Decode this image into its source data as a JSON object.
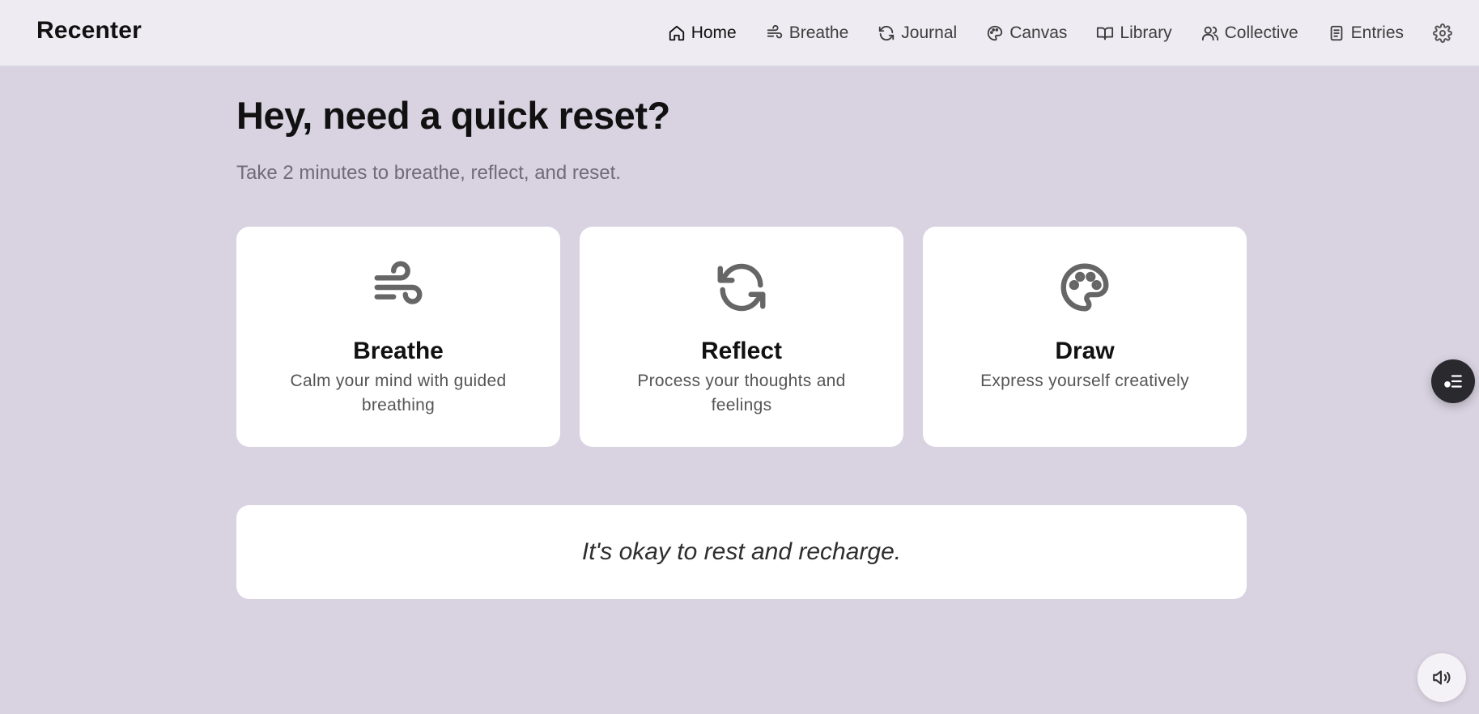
{
  "app": {
    "brand": "Recenter"
  },
  "nav": {
    "items": [
      {
        "label": "Home",
        "icon": "home-icon",
        "active": true
      },
      {
        "label": "Breathe",
        "icon": "wind-icon",
        "active": false
      },
      {
        "label": "Journal",
        "icon": "refresh-icon",
        "active": false
      },
      {
        "label": "Canvas",
        "icon": "palette-icon",
        "active": false
      },
      {
        "label": "Library",
        "icon": "book-icon",
        "active": false
      },
      {
        "label": "Collective",
        "icon": "users-icon",
        "active": false
      },
      {
        "label": "Entries",
        "icon": "document-icon",
        "active": false
      }
    ],
    "settings_icon": "gear-icon"
  },
  "hero": {
    "title": "Hey, need a quick reset?",
    "subtitle": "Take 2 minutes to breathe, reflect, and reset."
  },
  "cards": [
    {
      "title": "Breathe",
      "description": "Calm your mind with guided breathing",
      "icon": "wind-icon"
    },
    {
      "title": "Reflect",
      "description": "Process your thoughts and feelings",
      "icon": "refresh-icon"
    },
    {
      "title": "Draw",
      "description": "Express yourself creatively",
      "icon": "palette-icon"
    }
  ],
  "quote": {
    "text": "It's okay to rest and recharge."
  },
  "floating": {
    "list_button_icon": "list-check-icon",
    "sound_button_icon": "speaker-icon"
  },
  "colors": {
    "background": "#d9d3e1",
    "topbar": "#eeebf2",
    "card": "#ffffff",
    "icon": "#666666"
  }
}
